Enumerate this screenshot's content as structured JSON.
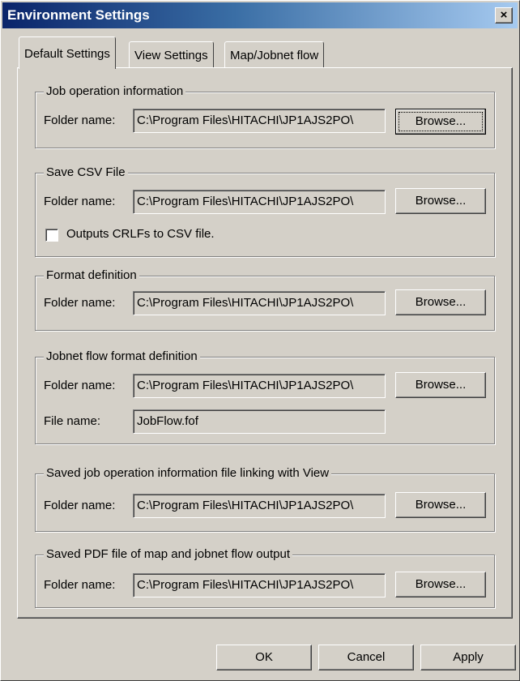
{
  "window": {
    "title": "Environment Settings",
    "close_glyph": "×"
  },
  "tabs": [
    {
      "label": "Default Settings",
      "active": true
    },
    {
      "label": "View Settings",
      "active": false
    },
    {
      "label": "Map/Jobnet flow",
      "active": false
    }
  ],
  "groups": {
    "job_operation": {
      "title": "Job operation information",
      "folder_label": "Folder name:",
      "folder_value": "C:\\Program Files\\HITACHI\\JP1AJS2PO\\",
      "browse_label": "Browse..."
    },
    "save_csv": {
      "title": "Save CSV File",
      "folder_label": "Folder name:",
      "folder_value": "C:\\Program Files\\HITACHI\\JP1AJS2PO\\",
      "browse_label": "Browse...",
      "checkbox_label": "Outputs CRLFs to CSV file.",
      "checkbox_checked": false
    },
    "format_definition": {
      "title": "Format definition",
      "folder_label": "Folder name:",
      "folder_value": "C:\\Program Files\\HITACHI\\JP1AJS2PO\\",
      "browse_label": "Browse..."
    },
    "jobnet_flow": {
      "title": "Jobnet flow format definition",
      "folder_label": "Folder name:",
      "folder_value": "C:\\Program Files\\HITACHI\\JP1AJS2PO\\",
      "browse_label": "Browse...",
      "file_label": "File name:",
      "file_value": "JobFlow.fof"
    },
    "saved_job_view": {
      "title": "Saved job operation information file linking with View",
      "folder_label": "Folder name:",
      "folder_value": "C:\\Program Files\\HITACHI\\JP1AJS2PO\\",
      "browse_label": "Browse..."
    },
    "saved_pdf": {
      "title": "Saved PDF file of map and jobnet flow output",
      "folder_label": "Folder name:",
      "folder_value": "C:\\Program Files\\HITACHI\\JP1AJS2PO\\",
      "browse_label": "Browse..."
    }
  },
  "buttons": {
    "ok": "OK",
    "cancel": "Cancel",
    "apply": "Apply"
  },
  "colors": {
    "face": "#d4d0c8",
    "title_start": "#0a246a",
    "title_end": "#a6caf0"
  }
}
